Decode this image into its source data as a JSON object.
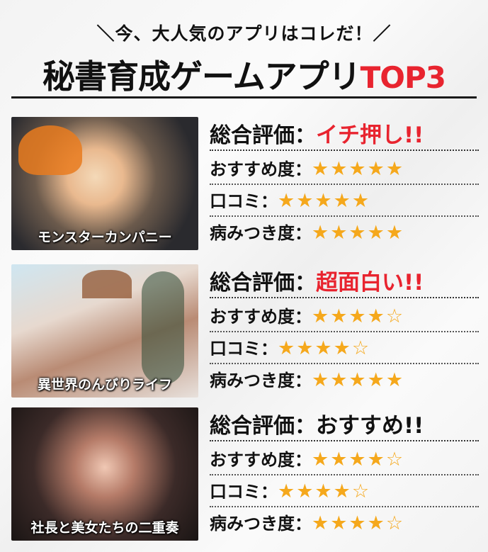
{
  "header": {
    "subtitle": "＼今、大人気のアプリはコレだ！／",
    "title_main": "秘書育成ゲームアプリ",
    "title_accent": "TOP3"
  },
  "labels": {
    "overall": "総合評価",
    "recommend": "おすすめ度",
    "reviews": "口コミ",
    "addictive": "病みつき度",
    "colon": "："
  },
  "games": [
    {
      "caption": "モンスターカンパニー",
      "overall": "イチ押し!!",
      "overall_color": "#e8242f",
      "recommend_stars": "★★★★★",
      "reviews_stars": "★★★★★",
      "addictive_stars": "★★★★★"
    },
    {
      "caption": "異世界のんびりライフ",
      "overall": "超面白い!!",
      "overall_color": "#e8242f",
      "recommend_stars": "★★★★☆",
      "reviews_stars": "★★★★☆",
      "addictive_stars": "★★★★★"
    },
    {
      "caption": "社長と美女たちの二重奏",
      "overall": "おすすめ!!",
      "overall_color": "#111111",
      "recommend_stars": "★★★★☆",
      "reviews_stars": "★★★★☆",
      "addictive_stars": "★★★★☆"
    }
  ]
}
